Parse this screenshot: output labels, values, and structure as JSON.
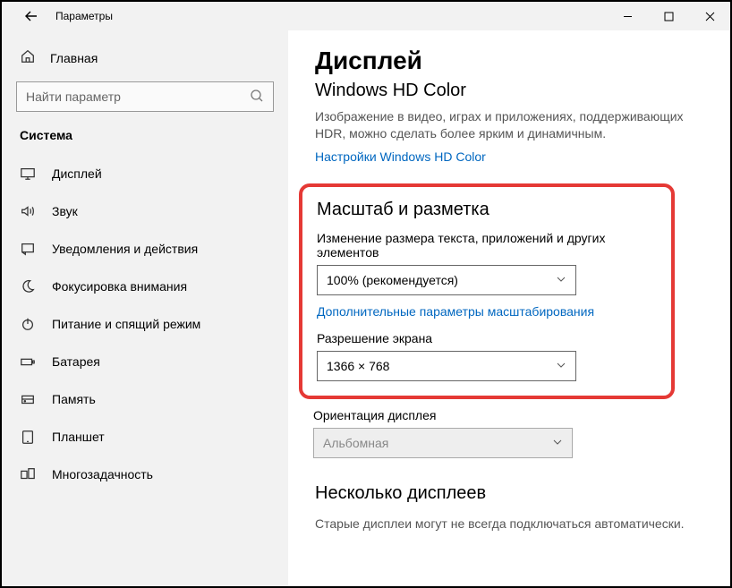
{
  "window": {
    "title": "Параметры"
  },
  "sidebar": {
    "home": "Главная",
    "search_placeholder": "Найти параметр",
    "section": "Система",
    "items": [
      {
        "label": "Дисплей"
      },
      {
        "label": "Звук"
      },
      {
        "label": "Уведомления и действия"
      },
      {
        "label": "Фокусировка внимания"
      },
      {
        "label": "Питание и спящий режим"
      },
      {
        "label": "Батарея"
      },
      {
        "label": "Память"
      },
      {
        "label": "Планшет"
      },
      {
        "label": "Многозадачность"
      }
    ]
  },
  "main": {
    "title": "Дисплей",
    "hd_title": "Windows HD Color",
    "hd_desc": "Изображение в видео, играх и приложениях, поддерживающих HDR, можно сделать более ярким и динамичным.",
    "hd_link": "Настройки Windows HD Color",
    "scale_section": "Масштаб и разметка",
    "scale_label": "Изменение размера текста, приложений и других элементов",
    "scale_value": "100% (рекомендуется)",
    "scale_link": "Дополнительные параметры масштабирования",
    "res_label": "Разрешение экрана",
    "res_value": "1366 × 768",
    "orient_label": "Ориентация дисплея",
    "orient_value": "Альбомная",
    "multi_title": "Несколько дисплеев",
    "multi_desc": "Старые дисплеи могут не всегда подключаться автоматически."
  }
}
